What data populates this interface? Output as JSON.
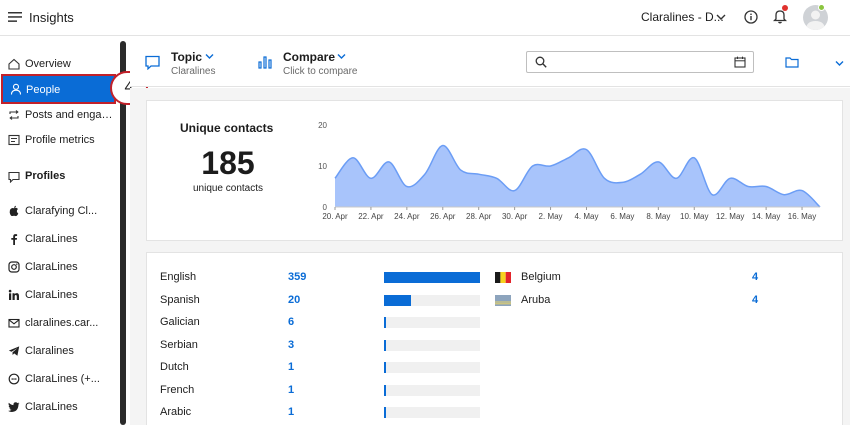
{
  "app": {
    "title": "Insights",
    "account": "Claralines - D...",
    "icons": [
      "menu-icon",
      "help-icon",
      "bell-icon",
      "avatar"
    ]
  },
  "sidebar": {
    "items": [
      {
        "label": "Overview",
        "icon": "home-icon"
      },
      {
        "label": "People",
        "icon": "person-icon",
        "active": true
      },
      {
        "label": "Posts and engage...",
        "icon": "repost-icon"
      },
      {
        "label": "Profile metrics",
        "icon": "metrics-icon"
      }
    ],
    "profiles_header": "Profiles",
    "profiles": [
      {
        "label": "Clarafying Cl...",
        "icon": "apple-icon"
      },
      {
        "label": "ClaraLines",
        "icon": "facebook-icon"
      },
      {
        "label": "ClaraLines",
        "icon": "instagram-icon"
      },
      {
        "label": "ClaraLines",
        "icon": "linkedin-icon"
      },
      {
        "label": "claralines.car...",
        "icon": "mail-icon"
      },
      {
        "label": "Claralines",
        "icon": "telegram-icon"
      },
      {
        "label": "ClaraLines (+...",
        "icon": "whatsapp-icon"
      },
      {
        "label": "ClaraLines",
        "icon": "twitter-icon"
      }
    ],
    "step_badge": "4"
  },
  "filterbar": {
    "topic_title": "Topic",
    "topic_sub": "Claralines",
    "compare_title": "Compare",
    "compare_sub": "Click to compare",
    "search_placeholder": ""
  },
  "unique_contacts": {
    "title": "Unique contacts",
    "value": "185",
    "sub": "unique contacts"
  },
  "chart_data": {
    "type": "area",
    "title": "",
    "xlabel": "",
    "ylabel": "",
    "ylim": [
      0,
      20
    ],
    "yticks": [
      "0",
      "10",
      "20"
    ],
    "tick_labels": [
      "20. Apr",
      "22. Apr",
      "24. Apr",
      "26. Apr",
      "28. Apr",
      "30. Apr",
      "2. May",
      "4. May",
      "6. May",
      "8. May",
      "10. May",
      "12. May",
      "14. May",
      "16. May"
    ],
    "x": [
      "20. Apr",
      "21. Apr",
      "22. Apr",
      "23. Apr",
      "24. Apr",
      "25. Apr",
      "26. Apr",
      "27. Apr",
      "28. Apr",
      "29. Apr",
      "30. Apr",
      "1. May",
      "2. May",
      "3. May",
      "4. May",
      "5. May",
      "6. May",
      "7. May",
      "8. May",
      "9. May",
      "10. May",
      "11. May",
      "12. May",
      "13. May",
      "14. May",
      "15. May",
      "16. May",
      "17. May"
    ],
    "values": [
      7,
      12,
      7,
      11,
      5,
      8,
      15,
      9,
      8,
      7,
      4,
      10,
      10,
      12,
      14,
      7,
      6,
      8,
      11,
      7,
      12,
      3,
      7,
      5,
      5,
      3,
      4,
      0
    ],
    "color": "#a8c4fb",
    "line_color": "#6b9df5"
  },
  "languages": [
    {
      "name": "English",
      "count": "359",
      "fraction": 1.0
    },
    {
      "name": "Spanish",
      "count": "20",
      "fraction": 0.28
    },
    {
      "name": "Galician",
      "count": "6",
      "fraction": 0.02
    },
    {
      "name": "Serbian",
      "count": "3",
      "fraction": 0.02
    },
    {
      "name": "Dutch",
      "count": "1",
      "fraction": 0.02
    },
    {
      "name": "French",
      "count": "1",
      "fraction": 0.02
    },
    {
      "name": "Arabic",
      "count": "1",
      "fraction": 0.02
    }
  ],
  "countries": [
    {
      "name": "Belgium",
      "count": "4",
      "flag": "belgium-flag"
    },
    {
      "name": "Aruba",
      "count": "4",
      "flag": "aruba-flag"
    }
  ],
  "colors": {
    "accent": "#0a6cd6",
    "highlight_border": "#c2212a",
    "area_fill": "#a8c4fb"
  }
}
